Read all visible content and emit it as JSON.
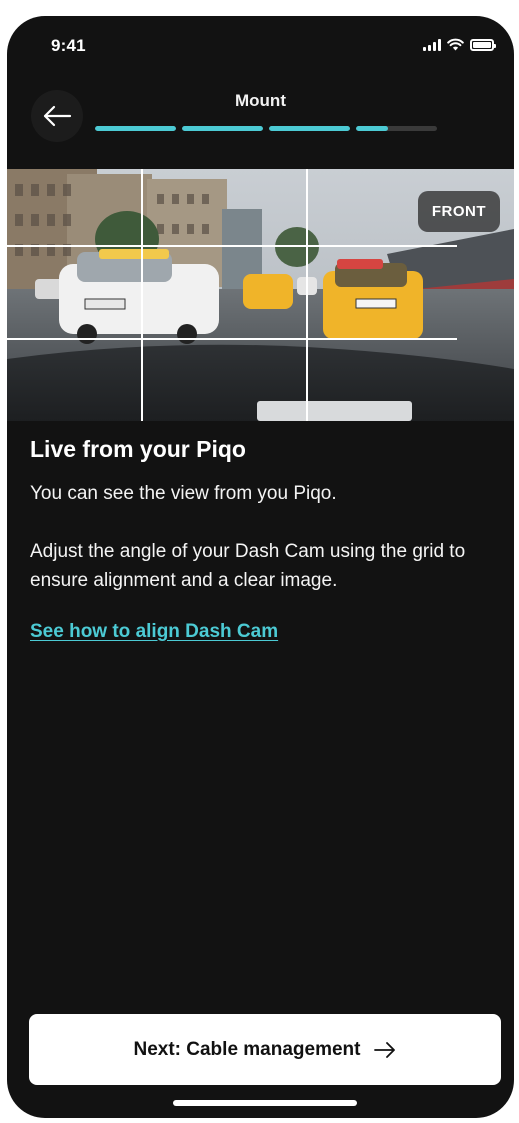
{
  "status_bar": {
    "time": "9:41"
  },
  "header": {
    "title": "Mount",
    "progress": [
      1,
      1,
      1,
      0.4
    ]
  },
  "camera": {
    "badge": "FRONT"
  },
  "content": {
    "title": "Live from your Piqo",
    "paragraph_1": "You can see the view from you Piqo.",
    "paragraph_2": "Adjust the angle of your Dash Cam using the grid to ensure alignment and a clear image.",
    "link": "See how to align Dash Cam"
  },
  "footer": {
    "next_button": "Next: Cable management"
  },
  "colors": {
    "background": "#121212",
    "accent": "#4ccad4",
    "button": "#ffffff"
  }
}
